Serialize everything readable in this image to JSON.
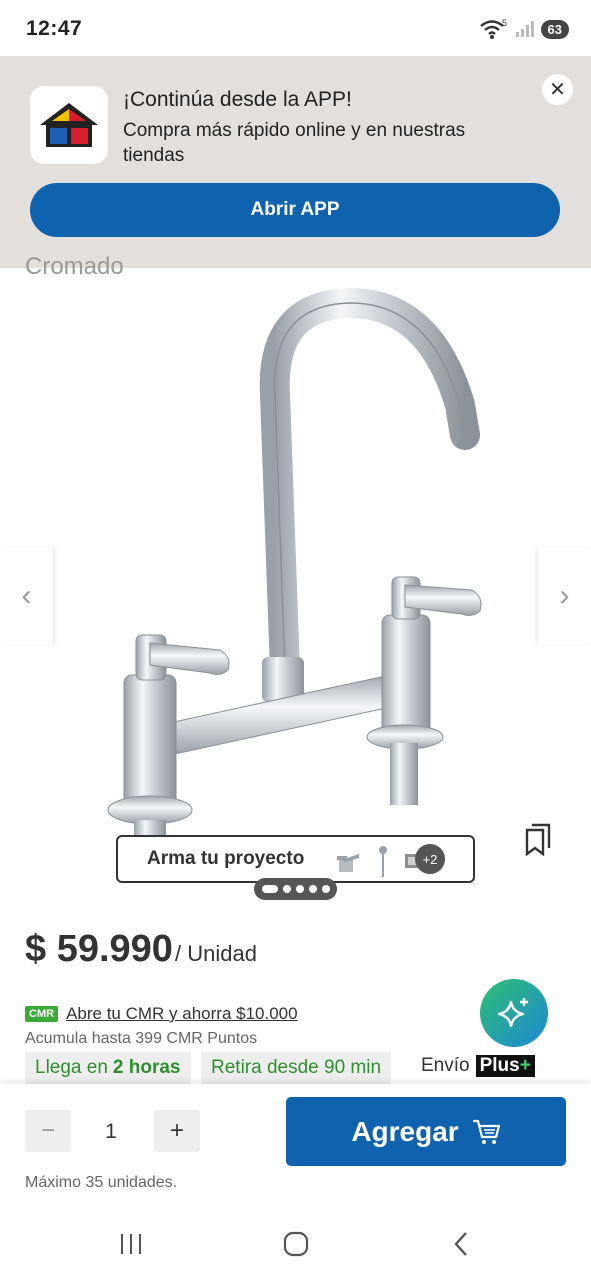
{
  "status": {
    "time": "12:47",
    "wifi_label": "5",
    "battery": "63"
  },
  "banner": {
    "title": "¡Continúa desde la APP!",
    "subtitle": "Compra más rápido online y en nuestras tiendas",
    "open_button": "Abrir APP"
  },
  "product": {
    "partial_title": "Cromado",
    "project_label": "Arma tu proyecto",
    "project_more": "+2",
    "price": "$ 59.990",
    "unit": "/ Unidad"
  },
  "cmr": {
    "badge": "CMR",
    "link": "Abre tu CMR y ahorra $10.000",
    "points": "Acumula hasta 399 CMR Puntos"
  },
  "delivery": {
    "chip1_prefix": "Llega en",
    "chip1_bold": "2 horas",
    "chip2": "Retira desde 90 min",
    "envio": "Envío",
    "plus_text": "Plus",
    "plus_sign": "+"
  },
  "cart": {
    "minus": "−",
    "quantity": "1",
    "plus": "+",
    "max_units": "Máximo 35 unidades.",
    "add_label": "Agregar"
  },
  "colors": {
    "primary_blue": "#0f62ad",
    "green": "#2f8f2f",
    "banner_bg": "#e2dfdc"
  }
}
